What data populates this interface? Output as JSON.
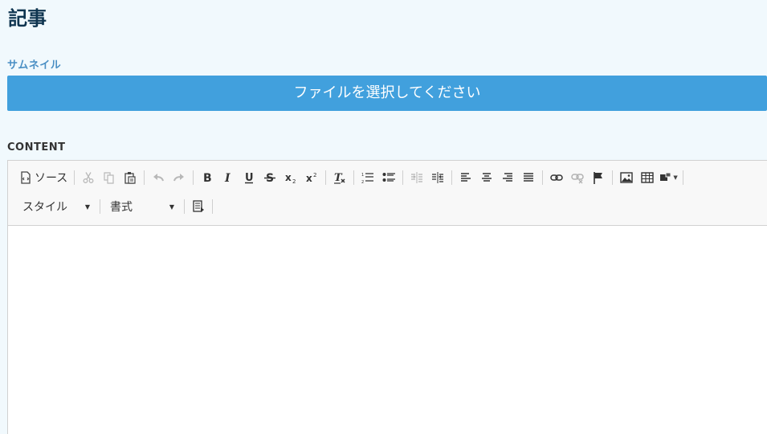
{
  "page": {
    "title": "記事"
  },
  "thumbnail": {
    "label": "サムネイル",
    "file_button_label": "ファイルを選択してください"
  },
  "content": {
    "label": "CONTENT",
    "toolbar": {
      "source_label": "ソース",
      "style_combo": "スタイル",
      "format_combo": "書式"
    }
  },
  "colors": {
    "background": "#f1f9fd",
    "accent": "#41a0dd",
    "title": "#0f3550",
    "thumb_label": "#4a8fc4"
  }
}
